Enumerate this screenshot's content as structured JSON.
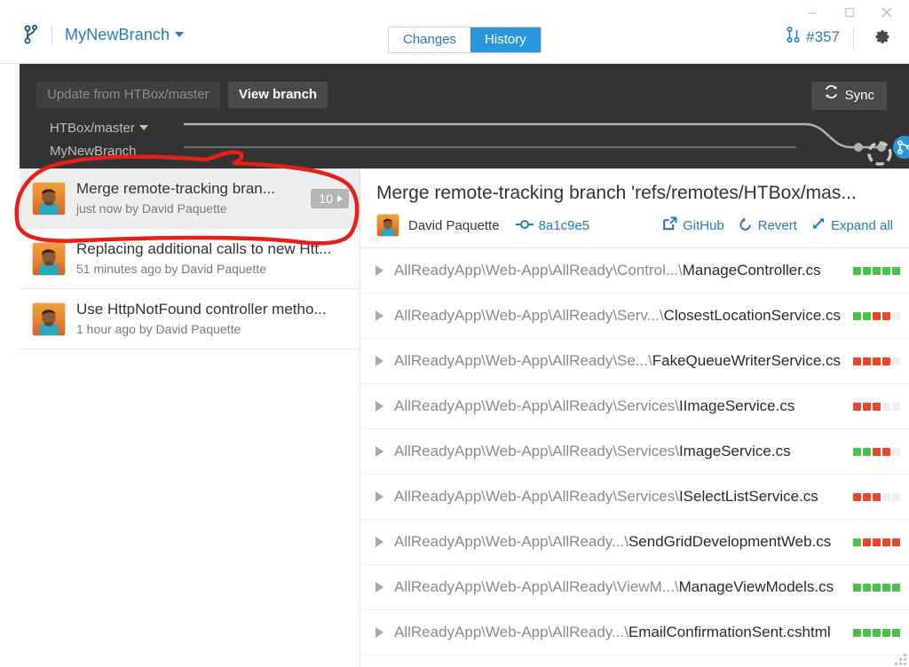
{
  "window": {
    "controls": [
      {
        "name": "minimize",
        "glyph": "minimize-icon"
      },
      {
        "name": "maximize",
        "glyph": "maximize-icon"
      },
      {
        "name": "close",
        "glyph": "close-icon"
      }
    ]
  },
  "header": {
    "repo_icon": "branch-icon",
    "branch_label": "MyNewBranch",
    "tabs": [
      {
        "label": "Changes",
        "active": false
      },
      {
        "label": "History",
        "active": true
      }
    ],
    "pull_request": "#357",
    "pull_request_icon": "pull-request-icon",
    "settings_icon": "gear-icon"
  },
  "toolbar": {
    "update_label": "Update from HTBox/master",
    "update_enabled": false,
    "view_branch_label": "View branch",
    "sync_label": "Sync",
    "sync_icon": "sync-icon",
    "graph_rows": [
      {
        "label": "HTBox/master",
        "has_caret": true
      },
      {
        "label": "MyNewBranch",
        "has_caret": false
      }
    ]
  },
  "commit_list": [
    {
      "title": "Merge remote-tracking bran...",
      "meta": "just now by David Paquette",
      "badge": "10",
      "selected": true
    },
    {
      "title": "Replacing additional calls to new Htt...",
      "meta": "51 minutes ago by David Paquette",
      "badge": null,
      "selected": false
    },
    {
      "title": "Use HttpNotFound controller metho...",
      "meta": "1 hour ago by David Paquette",
      "badge": null,
      "selected": false
    }
  ],
  "detail": {
    "title": "Merge remote-tracking branch 'refs/remotes/HTBox/mas...",
    "author": "David Paquette",
    "sha": "8a1c9e5",
    "sha_icon": "commit-icon",
    "actions": [
      {
        "label": "GitHub",
        "icon": "external-link-icon"
      },
      {
        "label": "Revert",
        "icon": "undo-icon"
      },
      {
        "label": "Expand all",
        "icon": "expand-icon"
      }
    ],
    "files": [
      {
        "dir": "AllReadyApp\\Web-App\\AllReady\\Control...\\",
        "name": "ManageController.cs",
        "blocks": [
          "add",
          "add",
          "add",
          "add",
          "add"
        ]
      },
      {
        "dir": "AllReadyApp\\Web-App\\AllReady\\Serv...\\",
        "name": "ClosestLocationService.cs",
        "blocks": [
          "add",
          "add",
          "del",
          "del",
          "none"
        ]
      },
      {
        "dir": "AllReadyApp\\Web-App\\AllReady\\Se...\\",
        "name": "FakeQueueWriterService.cs",
        "blocks": [
          "del",
          "del",
          "del",
          "del",
          "none"
        ]
      },
      {
        "dir": "AllReadyApp\\Web-App\\AllReady\\Services\\",
        "name": "IImageService.cs",
        "blocks": [
          "del",
          "del",
          "del",
          "none",
          "none"
        ]
      },
      {
        "dir": "AllReadyApp\\Web-App\\AllReady\\Services\\",
        "name": "ImageService.cs",
        "blocks": [
          "add",
          "add",
          "del",
          "del",
          "none"
        ]
      },
      {
        "dir": "AllReadyApp\\Web-App\\AllReady\\Services\\",
        "name": "ISelectListService.cs",
        "blocks": [
          "del",
          "del",
          "del",
          "none",
          "none"
        ]
      },
      {
        "dir": "AllReadyApp\\Web-App\\AllReady...\\",
        "name": "SendGridDevelopmentWeb.cs",
        "blocks": [
          "add",
          "del",
          "del",
          "del",
          "del"
        ]
      },
      {
        "dir": "AllReadyApp\\Web-App\\AllReady\\ViewM...\\",
        "name": "ManageViewModels.cs",
        "blocks": [
          "add",
          "add",
          "add",
          "add",
          "add"
        ]
      },
      {
        "dir": "AllReadyApp\\Web-App\\AllReady...\\",
        "name": "EmailConfirmationSent.cshtml",
        "blocks": [
          "add",
          "add",
          "add",
          "add",
          "add"
        ]
      }
    ]
  },
  "colors": {
    "accent_blue": "#2879c4",
    "tab_active": "#2a96dd",
    "dark_bar": "#333333",
    "added": "#4ac24a",
    "deleted": "#e8472a",
    "annotation": "#e81f16"
  }
}
